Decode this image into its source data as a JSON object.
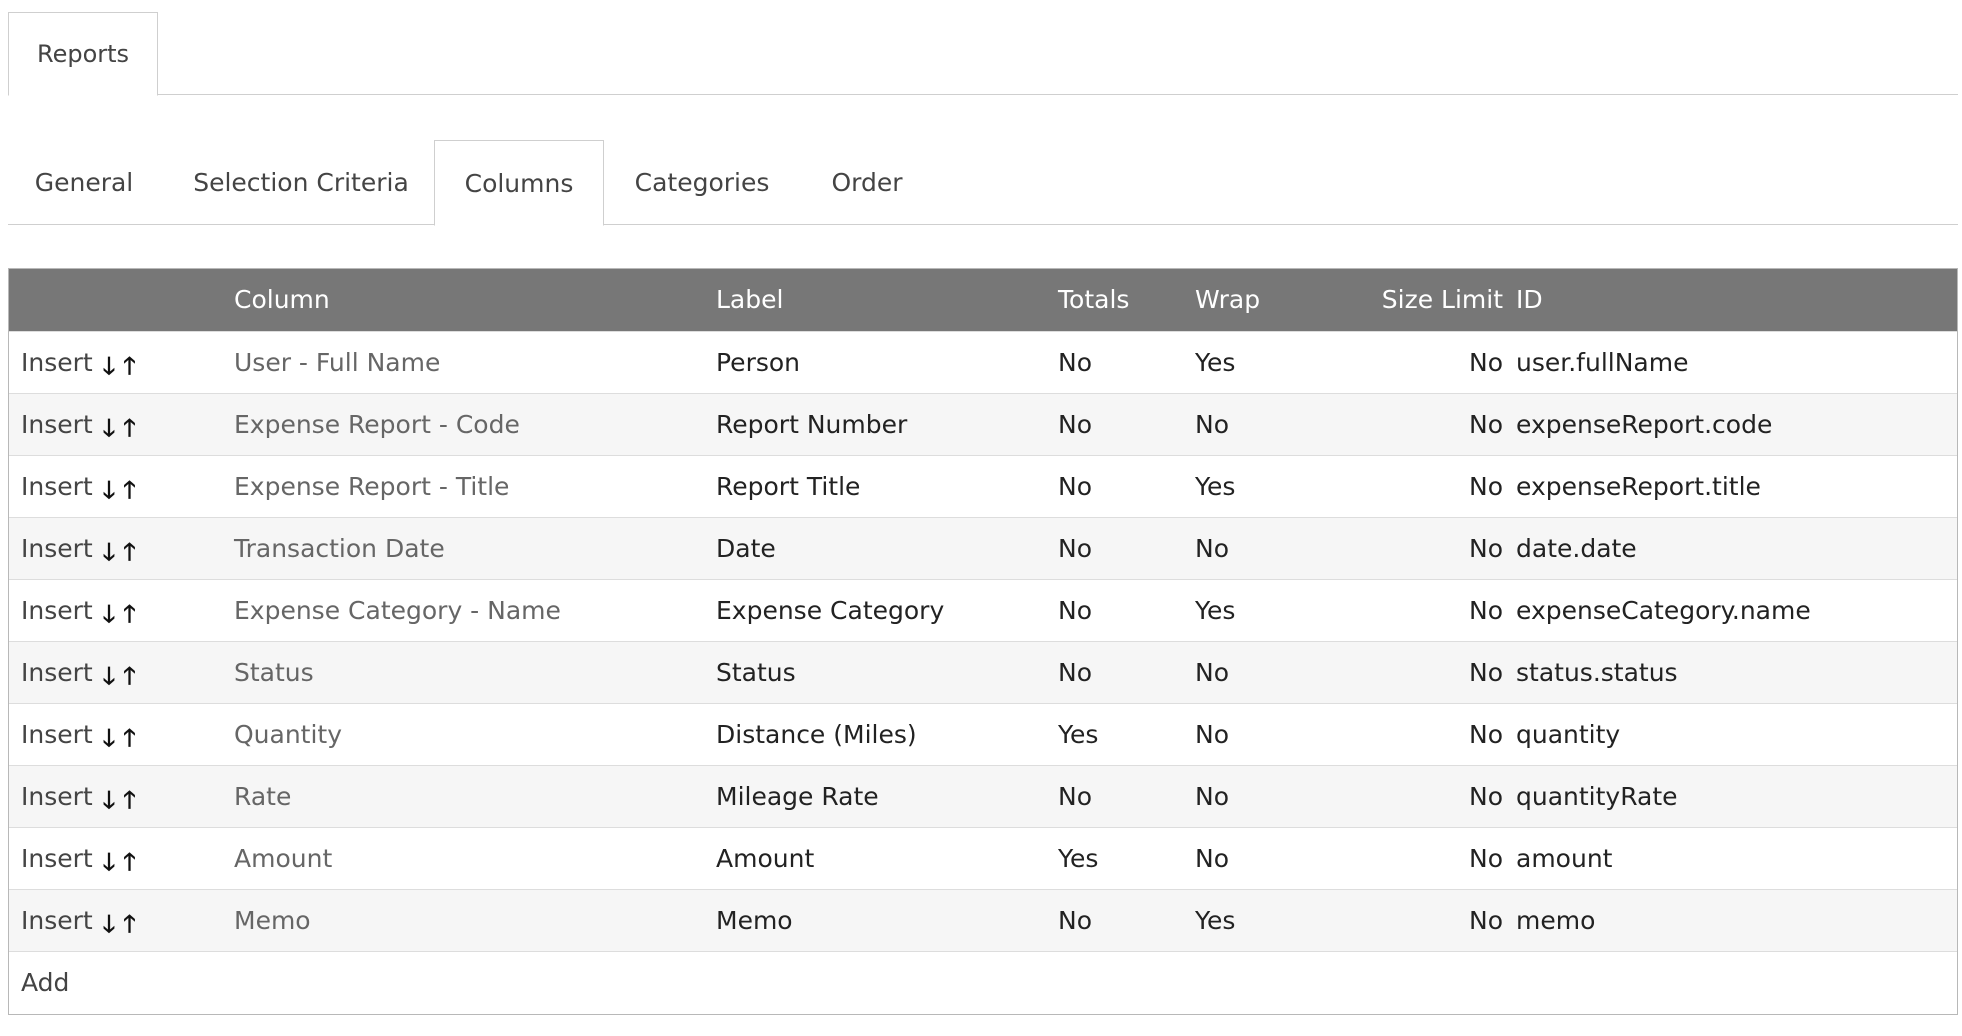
{
  "top_tabs": [
    "Reports"
  ],
  "sub_tabs": [
    "General",
    "Selection Criteria",
    "Columns",
    "Categories",
    "Order"
  ],
  "active_sub_tab": "Columns",
  "table": {
    "headers": {
      "actions": "",
      "column": "Column",
      "label": "Label",
      "totals": "Totals",
      "wrap": "Wrap",
      "size_limit": "Size Limit",
      "id": "ID"
    },
    "insert_label": "Insert",
    "down_arrow": "🡓",
    "up_arrow": "🡑",
    "rows": [
      {
        "column": "User - Full Name",
        "label": "Person",
        "totals": "No",
        "wrap": "Yes",
        "size_limit": "No",
        "id": "user.fullName"
      },
      {
        "column": "Expense Report - Code",
        "label": "Report Number",
        "totals": "No",
        "wrap": "No",
        "size_limit": "No",
        "id": "expenseReport.code"
      },
      {
        "column": "Expense Report - Title",
        "label": "Report Title",
        "totals": "No",
        "wrap": "Yes",
        "size_limit": "No",
        "id": "expenseReport.title"
      },
      {
        "column": "Transaction Date",
        "label": "Date",
        "totals": "No",
        "wrap": "No",
        "size_limit": "No",
        "id": "date.date"
      },
      {
        "column": "Expense Category - Name",
        "label": "Expense Category",
        "totals": "No",
        "wrap": "Yes",
        "size_limit": "No",
        "id": "expenseCategory.name"
      },
      {
        "column": "Status",
        "label": "Status",
        "totals": "No",
        "wrap": "No",
        "size_limit": "No",
        "id": "status.status"
      },
      {
        "column": "Quantity",
        "label": "Distance (Miles)",
        "totals": "Yes",
        "wrap": "No",
        "size_limit": "No",
        "id": "quantity"
      },
      {
        "column": "Rate",
        "label": "Mileage Rate",
        "totals": "No",
        "wrap": "No",
        "size_limit": "No",
        "id": "quantityRate"
      },
      {
        "column": "Amount",
        "label": "Amount",
        "totals": "Yes",
        "wrap": "No",
        "size_limit": "No",
        "id": "amount"
      },
      {
        "column": "Memo",
        "label": "Memo",
        "totals": "No",
        "wrap": "Yes",
        "size_limit": "No",
        "id": "memo"
      }
    ],
    "add_label": "Add"
  },
  "colors": {
    "header_bg": "#777777",
    "border": "#cfcfcf",
    "row_alt": "#f6f6f6"
  }
}
